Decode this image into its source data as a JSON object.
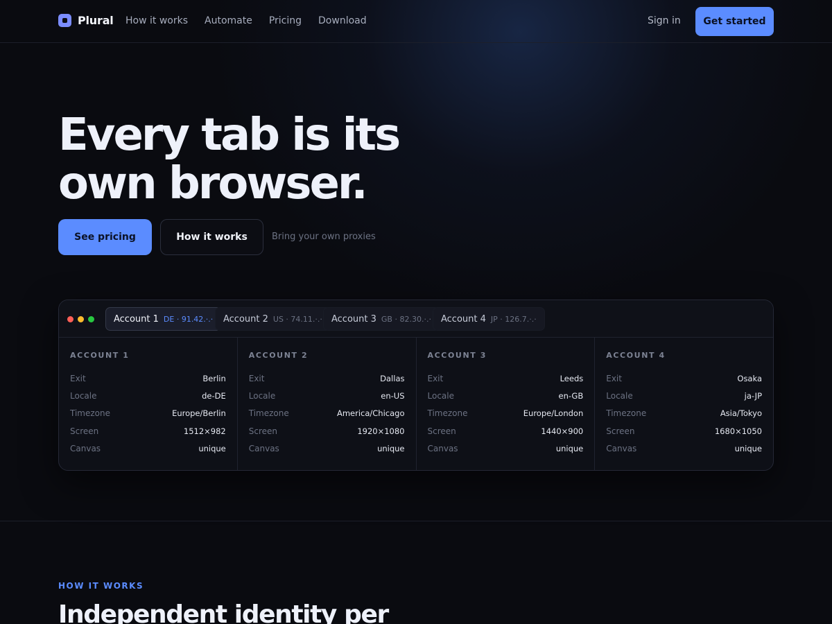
{
  "nav": {
    "brand": "Plural",
    "links": [
      "How it works",
      "Automate",
      "Pricing",
      "Download"
    ],
    "sign_in": "Sign in",
    "cta": "Get started"
  },
  "hero": {
    "title_line1": "Every tab is its",
    "title_line2": "own browser.",
    "primary_button": "See pricing",
    "secondary_button": "How it works",
    "note": "Bring your own proxies"
  },
  "browser": {
    "tabs": [
      {
        "name": "Account 1",
        "meta": "DE · 91.42.·.·",
        "active": true
      },
      {
        "name": "Account 2",
        "meta": "US · 74.11.·.·",
        "active": false
      },
      {
        "name": "Account 3",
        "meta": "GB · 82.30.·.·",
        "active": false
      },
      {
        "name": "Account 4",
        "meta": "JP · 126.7.·.·",
        "active": false
      }
    ],
    "field_labels": [
      "Exit",
      "Locale",
      "Timezone",
      "Screen",
      "Canvas"
    ],
    "panels": [
      {
        "title": "ACCOUNT 1",
        "values": [
          "Berlin",
          "de-DE",
          "Europe/Berlin",
          "1512×982",
          "unique"
        ]
      },
      {
        "title": "ACCOUNT 2",
        "values": [
          "Dallas",
          "en-US",
          "America/Chicago",
          "1920×1080",
          "unique"
        ]
      },
      {
        "title": "ACCOUNT 3",
        "values": [
          "Leeds",
          "en-GB",
          "Europe/London",
          "1440×900",
          "unique"
        ]
      },
      {
        "title": "ACCOUNT 4",
        "values": [
          "Osaka",
          "ja-JP",
          "Asia/Tokyo",
          "1680×1050",
          "unique"
        ]
      }
    ]
  },
  "section": {
    "eyebrow": "HOW IT WORKS",
    "title": "Independent identity per"
  },
  "colors": {
    "accent": "#5b8cff",
    "background": "#0a0b10",
    "window_red": "#ff5f57",
    "window_yellow": "#febc2e",
    "window_green": "#28c840"
  }
}
